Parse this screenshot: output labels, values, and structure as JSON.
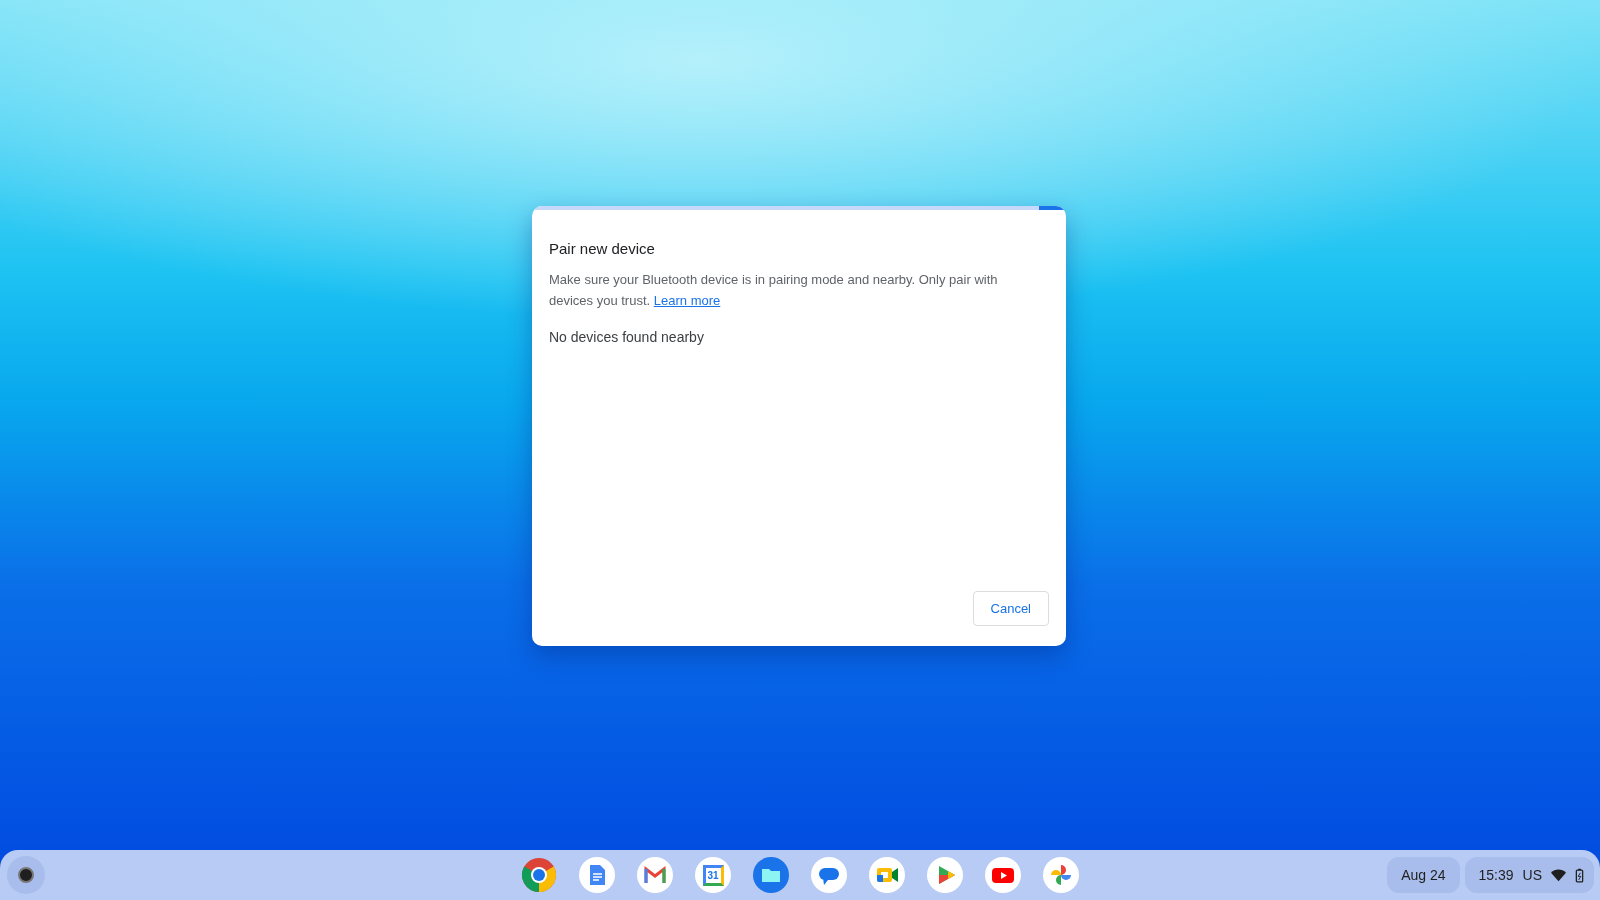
{
  "dialog": {
    "title": "Pair new device",
    "description": "Make sure your Bluetooth device is in pairing mode and nearby. Only pair with devices you trust.",
    "link": "Learn more",
    "status": "No devices found nearby",
    "buttons": [
      "Cancel"
    ]
  },
  "shelf": {
    "apps": [
      {
        "kind": "chrome"
      },
      {
        "kind": "docs"
      },
      {
        "kind": "gmail"
      },
      {
        "kind": "calendar",
        "label": "31"
      },
      {
        "kind": "files"
      },
      {
        "kind": "messages"
      },
      {
        "kind": "meet"
      },
      {
        "kind": "play"
      },
      {
        "kind": "youtube"
      },
      {
        "kind": "photos"
      }
    ],
    "date": "Aug 24",
    "time": "15:39",
    "keyboard": "US"
  }
}
